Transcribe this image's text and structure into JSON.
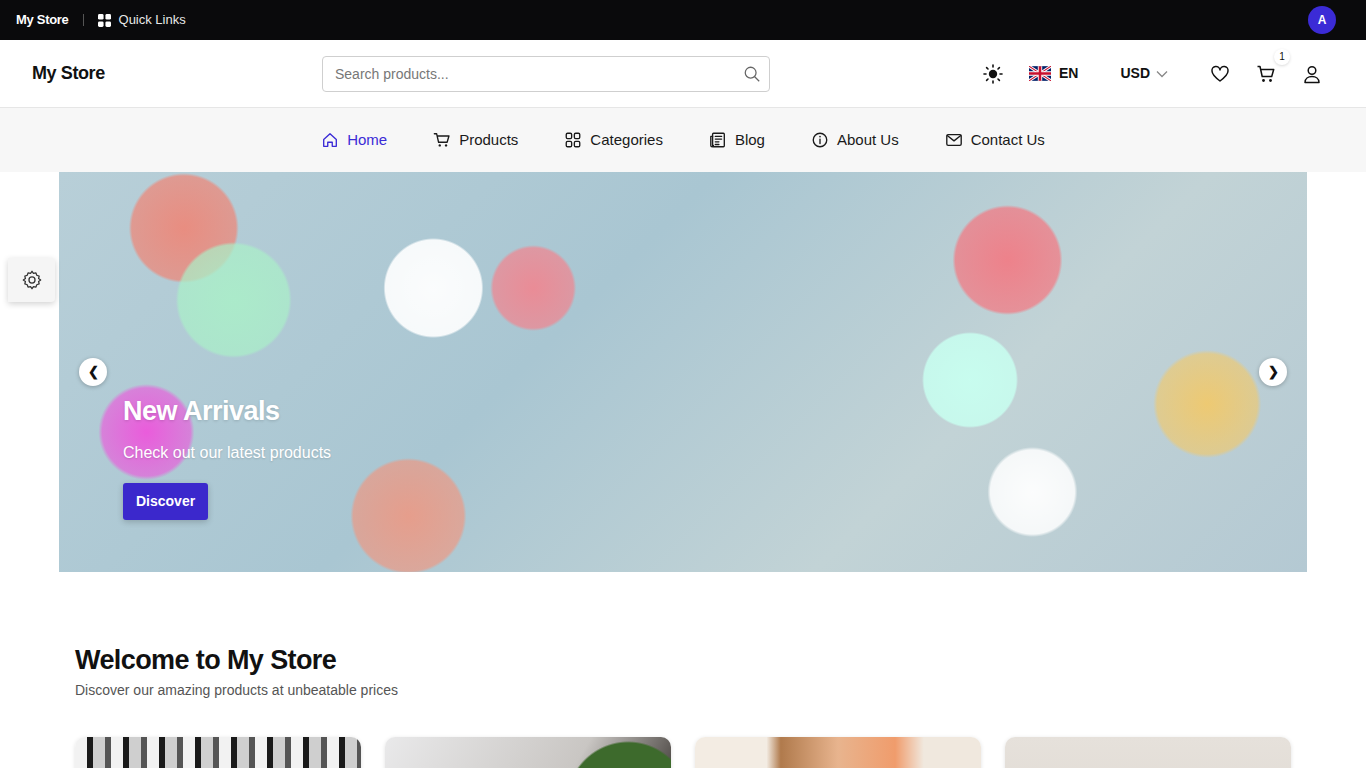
{
  "topbar": {
    "brand": "My Store",
    "quick_links": "Quick Links",
    "avatar": "A"
  },
  "header": {
    "logo": "My Store",
    "search": {
      "placeholder": "Search products..."
    },
    "language": "EN",
    "currency": "USD",
    "cart_count": "1"
  },
  "nav": [
    {
      "label": "Home",
      "selected": true
    },
    {
      "label": "Products",
      "selected": false
    },
    {
      "label": "Categories",
      "selected": false
    },
    {
      "label": "Blog",
      "selected": false
    },
    {
      "label": "About Us",
      "selected": false
    },
    {
      "label": "Contact Us",
      "selected": false
    }
  ],
  "hero": {
    "title": "New Arrivals",
    "subtitle": "Check out our latest products",
    "button": "Discover",
    "prev": "❮",
    "next": "❯"
  },
  "welcome": {
    "title": "Welcome to My Store",
    "subtitle": "Discover our amazing products at unbeatable prices"
  }
}
